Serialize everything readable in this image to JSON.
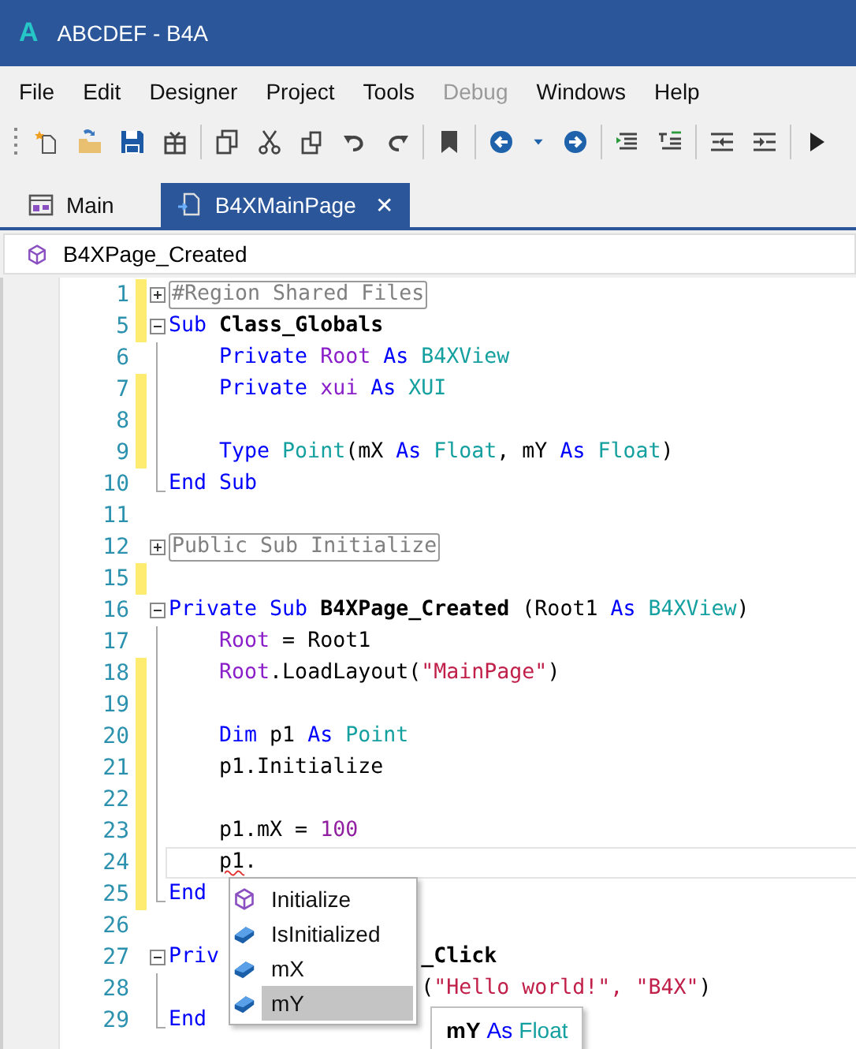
{
  "window": {
    "title": "ABCDEF - B4A",
    "app_letter": "A"
  },
  "menu": [
    {
      "label": "File",
      "disabled": false
    },
    {
      "label": "Edit",
      "disabled": false
    },
    {
      "label": "Designer",
      "disabled": false
    },
    {
      "label": "Project",
      "disabled": false
    },
    {
      "label": "Tools",
      "disabled": false
    },
    {
      "label": "Debug",
      "disabled": true
    },
    {
      "label": "Windows",
      "disabled": false
    },
    {
      "label": "Help",
      "disabled": false
    }
  ],
  "tabs": [
    {
      "label": "Main",
      "selected": false,
      "closable": false
    },
    {
      "label": "B4XMainPage",
      "selected": true,
      "closable": true,
      "close_glyph": "✕"
    }
  ],
  "breadcrumb": "B4XPage_Created",
  "code": [
    {
      "number": "1",
      "kind": "fold-closed",
      "changed": true,
      "indented": false,
      "current": false,
      "words": [
        [
          {
            "text": "#Region Shared Files",
            "kind": "collapsed"
          }
        ]
      ]
    },
    {
      "number": "5",
      "kind": "fold-open",
      "changed": true,
      "indented": false,
      "current": false,
      "words": [
        [
          {
            "text": "Sub",
            "kind": "keyword"
          }
        ],
        [
          {
            "text": "Class_Globals",
            "kind": "bold"
          }
        ]
      ]
    },
    {
      "number": "6",
      "kind": "body",
      "changed": false,
      "indented": true,
      "current": false,
      "words": [
        [
          {
            "text": "Private",
            "kind": "keyword"
          }
        ],
        [
          {
            "text": "Root",
            "kind": "var"
          }
        ],
        [
          {
            "text": "As",
            "kind": "keyword"
          }
        ],
        [
          {
            "text": "B4XView",
            "kind": "type"
          }
        ]
      ]
    },
    {
      "number": "7",
      "kind": "body",
      "changed": true,
      "indented": true,
      "current": false,
      "words": [
        [
          {
            "text": "Private",
            "kind": "keyword"
          }
        ],
        [
          {
            "text": "xui",
            "kind": "var"
          }
        ],
        [
          {
            "text": "As",
            "kind": "keyword"
          }
        ],
        [
          {
            "text": "XUI",
            "kind": "type"
          }
        ]
      ]
    },
    {
      "number": "8",
      "kind": "body",
      "changed": true,
      "current": false
    },
    {
      "number": "9",
      "kind": "body",
      "changed": true,
      "indented": true,
      "current": false,
      "words": [
        [
          {
            "text": "Type",
            "kind": "keyword"
          }
        ],
        [
          {
            "text": "Point",
            "kind": "type"
          },
          {
            "text": "(mX",
            "kind": "plain"
          }
        ],
        [
          {
            "text": "As",
            "kind": "keyword"
          }
        ],
        [
          {
            "text": "Float",
            "kind": "type"
          },
          {
            "text": ",",
            "kind": "plain"
          }
        ],
        [
          {
            "text": "mY",
            "kind": "plain"
          }
        ],
        [
          {
            "text": "As",
            "kind": "keyword"
          }
        ],
        [
          {
            "text": "Float",
            "kind": "type"
          },
          {
            "text": ")",
            "kind": "plain"
          }
        ]
      ]
    },
    {
      "number": "10",
      "kind": "fold-end",
      "changed": false,
      "indented": false,
      "current": false,
      "words": [
        [
          {
            "text": "End",
            "kind": "keyword"
          }
        ],
        [
          {
            "text": "Sub",
            "kind": "keyword"
          }
        ]
      ]
    },
    {
      "number": "11",
      "kind": "plain",
      "changed": false,
      "current": false
    },
    {
      "number": "12",
      "kind": "fold-closed",
      "changed": false,
      "indented": false,
      "current": false,
      "words": [
        [
          {
            "text": "Public Sub Initialize",
            "kind": "collapsed"
          }
        ]
      ]
    },
    {
      "number": "15",
      "kind": "plain",
      "changed": true,
      "current": false
    },
    {
      "number": "16",
      "kind": "fold-open",
      "changed": false,
      "indented": false,
      "current": false,
      "words": [
        [
          {
            "text": "Private",
            "kind": "keyword"
          }
        ],
        [
          {
            "text": "Sub",
            "kind": "keyword"
          }
        ],
        [
          {
            "text": "B4XPage_Created",
            "kind": "bold"
          }
        ],
        [
          {
            "text": "(Root1",
            "kind": "plain"
          }
        ],
        [
          {
            "text": "As",
            "kind": "keyword"
          }
        ],
        [
          {
            "text": "B4XView",
            "kind": "type"
          },
          {
            "text": ")",
            "kind": "plain"
          }
        ]
      ]
    },
    {
      "number": "17",
      "kind": "body",
      "changed": false,
      "indented": true,
      "current": false,
      "words": [
        [
          {
            "text": "Root",
            "kind": "var"
          }
        ],
        [
          {
            "text": "=",
            "kind": "plain"
          }
        ],
        [
          {
            "text": "Root1",
            "kind": "plain"
          }
        ]
      ]
    },
    {
      "number": "18",
      "kind": "body",
      "changed": true,
      "indented": true,
      "current": false,
      "words": [
        [
          {
            "text": "Root",
            "kind": "var"
          },
          {
            "text": ".LoadLayout(",
            "kind": "plain"
          },
          {
            "text": "\"MainPage\"",
            "kind": "string"
          },
          {
            "text": ")",
            "kind": "plain"
          }
        ]
      ]
    },
    {
      "number": "19",
      "kind": "body",
      "changed": true,
      "current": false
    },
    {
      "number": "20",
      "kind": "body",
      "changed": true,
      "indented": true,
      "current": false,
      "words": [
        [
          {
            "text": "Dim",
            "kind": "keyword"
          }
        ],
        [
          {
            "text": "p1",
            "kind": "plain"
          }
        ],
        [
          {
            "text": "As",
            "kind": "keyword"
          }
        ],
        [
          {
            "text": "Point",
            "kind": "type"
          }
        ]
      ]
    },
    {
      "number": "21",
      "kind": "body",
      "changed": true,
      "indented": true,
      "current": false,
      "words": [
        [
          {
            "text": "p1.Initialize",
            "kind": "plain"
          }
        ]
      ]
    },
    {
      "number": "22",
      "kind": "body",
      "changed": true,
      "current": false
    },
    {
      "number": "23",
      "kind": "body",
      "changed": true,
      "indented": true,
      "current": false,
      "words": [
        [
          {
            "text": "p1.mX",
            "kind": "plain"
          }
        ],
        [
          {
            "text": "=",
            "kind": "plain"
          }
        ],
        [
          {
            "text": "100",
            "kind": "number"
          }
        ]
      ]
    },
    {
      "number": "24",
      "kind": "body",
      "changed": true,
      "indented": true,
      "current": true,
      "words": [
        [
          {
            "text": "p1",
            "kind": "error"
          },
          {
            "text": ".",
            "kind": "plain"
          }
        ]
      ]
    },
    {
      "number": "25",
      "kind": "fold-end",
      "changed": true,
      "indented": false,
      "current": false,
      "words": [
        [
          {
            "text": "End",
            "kind": "keyword"
          }
        ]
      ]
    },
    {
      "number": "26",
      "kind": "plain",
      "changed": false,
      "current": false
    },
    {
      "number": "27",
      "kind": "fold-open",
      "changed": false,
      "indented": false,
      "current": false,
      "words": [
        [
          {
            "text": "Priv",
            "kind": "keyword"
          },
          {
            "kind": "covered"
          },
          {
            "text": "_Click",
            "kind": "bold"
          }
        ]
      ]
    },
    {
      "number": "28",
      "kind": "body",
      "changed": false,
      "indented": false,
      "current": false,
      "words": [
        [
          {
            "kind": "covered"
          },
          {
            "text": "(",
            "kind": "plain"
          },
          {
            "text": "\"Hello world!\",",
            "kind": "string"
          }
        ],
        [
          {
            "text": "\"B4X\"",
            "kind": "string"
          },
          {
            "text": ")",
            "kind": "plain"
          }
        ]
      ]
    },
    {
      "number": "29",
      "kind": "fold-end",
      "changed": false,
      "indented": false,
      "current": false,
      "words": [
        [
          {
            "text": "End",
            "kind": "keyword"
          }
        ]
      ]
    }
  ],
  "autocomplete": {
    "items": [
      {
        "label": "Initialize",
        "kind": "method",
        "selected": false
      },
      {
        "label": "IsInitialized",
        "kind": "field",
        "selected": false
      },
      {
        "label": "mX",
        "kind": "field",
        "selected": false
      },
      {
        "label": "mY",
        "kind": "field",
        "selected": true
      }
    ],
    "tooltip": [
      {
        "text": "mY",
        "kind": "bold"
      },
      {
        "text": "As",
        "kind": "keyword"
      },
      {
        "text": "Float",
        "kind": "type"
      }
    ]
  }
}
